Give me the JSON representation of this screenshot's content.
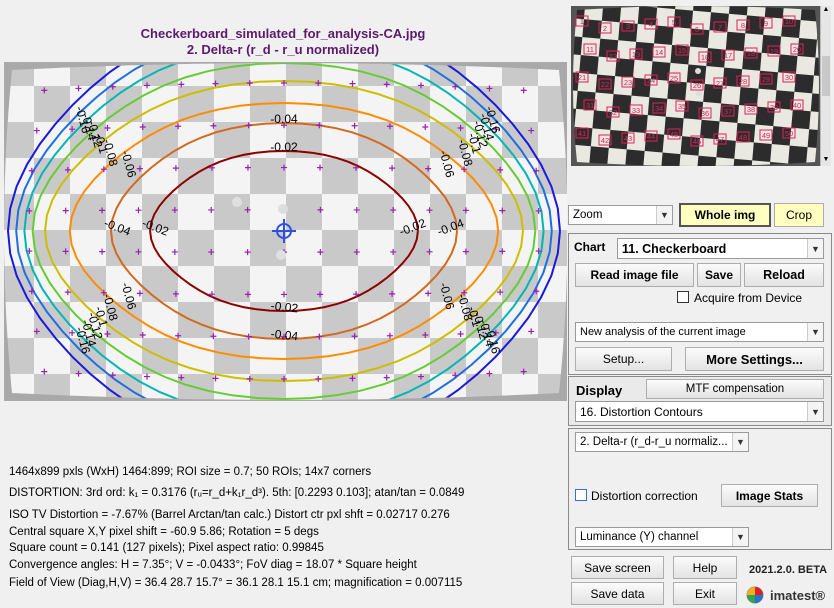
{
  "header": {
    "filename": "Checkerboard_simulated_for_analysis-CA.jpg",
    "subtitle": "2. Delta-r (r_d - r_u normalized)"
  },
  "plot": {
    "contour_labels": [
      "-0.02",
      "-0.02",
      "-0.02",
      "-0.02",
      "-0.04",
      "-0.04",
      "-0.04",
      "-0.04",
      "-0.06",
      "-0.06",
      "-0.06",
      "-0.06",
      "-0.08",
      "-0.08",
      "-0.08",
      "-0.08",
      "-0.1",
      "-0.1",
      "-0.1",
      "-0.1",
      "-0.12",
      "-0.12",
      "-0.12",
      "-0.12",
      "-0.14",
      "-0.14",
      "-0.14",
      "-0.14",
      "-0.16",
      "-0.16",
      "-0.16",
      "-0.16"
    ],
    "contour_colors": [
      "#8b0000",
      "#d2691e",
      "#ff8c00",
      "#cdbe00",
      "#66cc33",
      "#00b5b5",
      "#1e6fe0",
      "#1a1adc"
    ]
  },
  "info": {
    "line1": "1464x899 pxls (WxH) 1464:899;    ROI size = 0.7;   50 ROIs;   14x7 corners",
    "line2": "DISTORTION:  3rd ord:  k₁ = 0.3176  (rᵤ=r_d+k₁r_d³).    5th: [0.2293  0.103];     atan/tan = 0.0849",
    "line3": "ISO TV Distortion = -7.67%  (Barrel   Arctan/tan calc.)  Distort ctr pxl shft = 0.02717 0.276",
    "line4": "Central square X,Y pixel shift = -60.9  5.86;    Rotation = 5 degs",
    "line5": "Square count = 0.141  (127 pixels);  Pixel aspect ratio: 0.99845",
    "line6": "Convergence angles:  H = 7.35°;  V = -0.0433°;    FoV diag = 18.07 * Square height",
    "line7": "Field of View (Diag,H,V) = 36.4  28.7  15.7°  = 36.1  28.1  15.1 cm;   magnification = 0.007115"
  },
  "thumbnail": {
    "roi_labels": [
      "1",
      "2",
      "3",
      "4",
      "5",
      "6",
      "7",
      "8",
      "9",
      "10",
      "11",
      "12",
      "13",
      "14",
      "15",
      "16",
      "17",
      "18",
      "19",
      "20",
      "21",
      "22",
      "23",
      "24",
      "25",
      "26",
      "27",
      "28",
      "29",
      "30",
      "31",
      "32",
      "33",
      "34",
      "35",
      "36",
      "37",
      "38",
      "39",
      "40",
      "41",
      "42",
      "43",
      "44",
      "45",
      "46",
      "47",
      "48",
      "49",
      "50"
    ]
  },
  "controls": {
    "zoom_value": "Zoom",
    "whole_img": "Whole img",
    "crop": "Crop",
    "chart_label": "Chart",
    "chart_value": "11. Checkerboard",
    "read_image": "Read image file",
    "save": "Save",
    "reload": "Reload",
    "acquire": "Acquire from Device",
    "analysis_value": "New analysis of the current image",
    "setup": "Setup...",
    "more_settings": "More Settings...",
    "display_label": "Display",
    "mtf_comp": "MTF compensation",
    "display_value": "16. Distortion Contours",
    "plot_value": "2. Delta-r (r_d-r_u normaliz...",
    "distortion_corr": "Distortion correction",
    "image_stats": "Image Stats",
    "channel_value": "Luminance (Y) channel",
    "save_screen": "Save screen",
    "help": "Help",
    "version": "2021.2.0. BETA",
    "save_data": "Save data",
    "exit": "Exit",
    "brand": "imatest®"
  }
}
